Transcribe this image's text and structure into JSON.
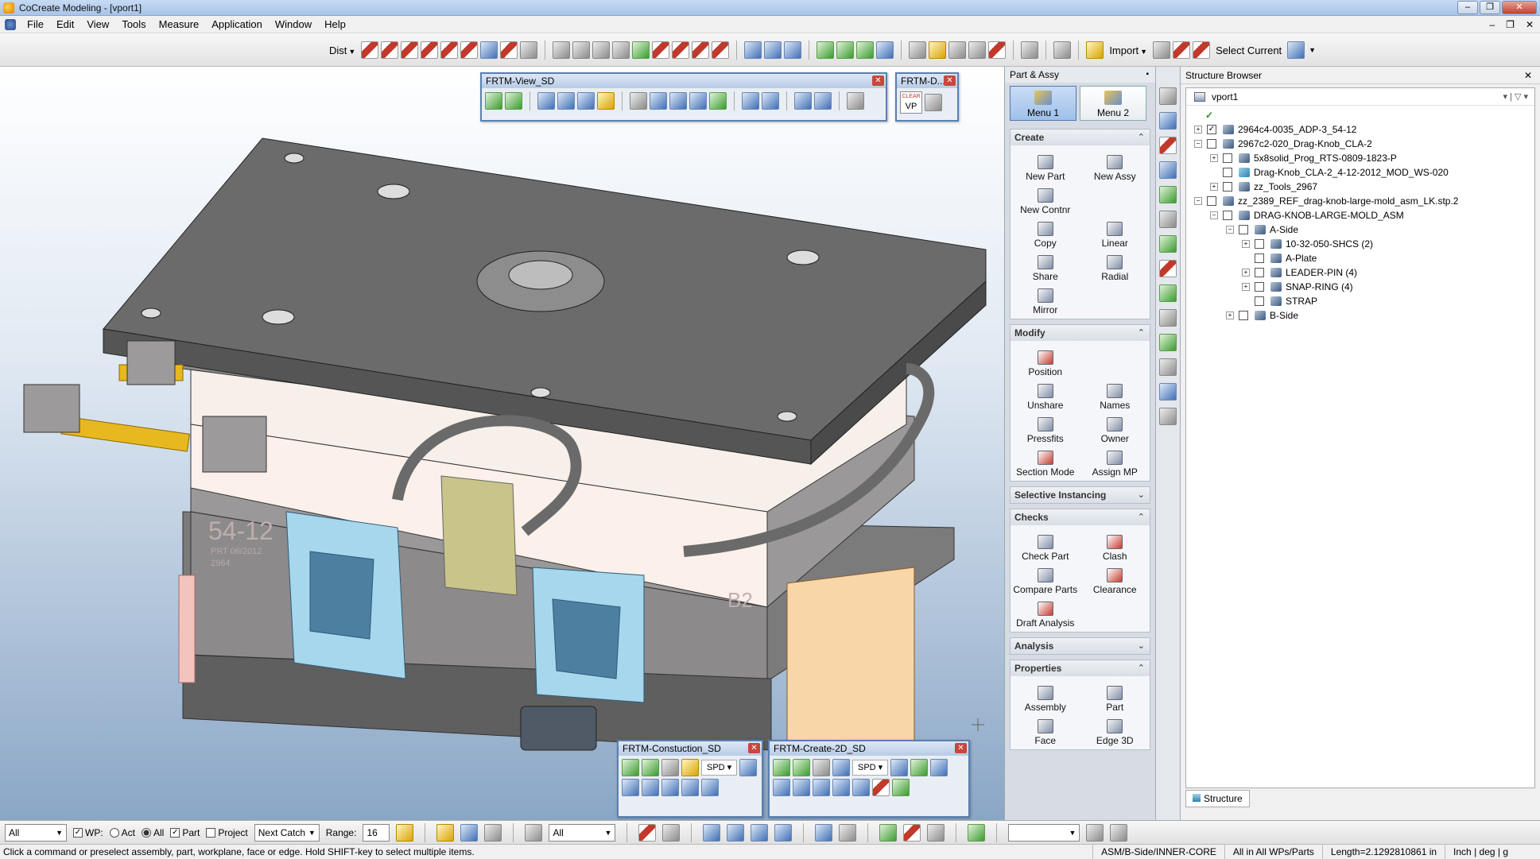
{
  "window": {
    "title": "CoCreate Modeling - [vport1]"
  },
  "menu": [
    "File",
    "Edit",
    "View",
    "Tools",
    "Measure",
    "Application",
    "Window",
    "Help"
  ],
  "toolbar": {
    "dist_label": "Dist",
    "import_label": "Import",
    "select_current_label": "Select Current"
  },
  "float_toolbars": {
    "view": {
      "title": "FRTM-View_SD"
    },
    "vp": {
      "title": "FRTM-D...",
      "clear_label": "CLEAR",
      "vp_label": "VP"
    },
    "construction": {
      "title": "FRTM-Constuction_SD",
      "spd": "SPD"
    },
    "create2d": {
      "title": "FRTM-Create-2D_SD",
      "spd": "SPD"
    }
  },
  "part_assy": {
    "title": "Part & Assy",
    "tabs": [
      "Menu 1",
      "Menu 2"
    ],
    "sections": [
      {
        "title": "Create",
        "collapsible": "up",
        "items": [
          "New Part",
          "New Assy",
          "New Contnr",
          "",
          "Copy",
          "Linear",
          "Share",
          "Radial",
          "Mirror",
          ""
        ]
      },
      {
        "title": "Modify",
        "collapsible": "up",
        "items": [
          "Position",
          "",
          "Unshare",
          "Names",
          "Pressfits",
          "Owner",
          "Section Mode",
          "Assign MP"
        ]
      },
      {
        "title": "Selective Instancing",
        "collapsible": "down",
        "items": []
      },
      {
        "title": "Checks",
        "collapsible": "up",
        "items": [
          "Check Part",
          "Clash",
          "Compare Parts",
          "Clearance",
          "Draft Analysis",
          ""
        ]
      },
      {
        "title": "Analysis",
        "collapsible": "down",
        "items": []
      },
      {
        "title": "Properties",
        "collapsible": "up",
        "items": [
          "Assembly",
          "Part",
          "Face",
          "Edge 3D"
        ]
      }
    ]
  },
  "structure_browser": {
    "title": "Structure Browser",
    "root": "vport1",
    "rows": [
      {
        "label": "2964c4-0035_ADP-3_54-12",
        "checked": true,
        "type": "asm"
      },
      {
        "label": "2967c2-020_Drag-Knob_CLA-2",
        "checked": false,
        "type": "asm"
      },
      {
        "label": "5x8solid_Prog_RTS-0809-1823-P",
        "checked": false,
        "type": "asm"
      },
      {
        "label": "Drag-Knob_CLA-2_4-12-2012_MOD_WS-020",
        "checked": false,
        "type": "part"
      },
      {
        "label": "zz_Tools_2967",
        "checked": false,
        "type": "asm"
      },
      {
        "label": "zz_2389_REF_drag-knob-large-mold_asm_LK.stp.2",
        "checked": false,
        "type": "asm"
      },
      {
        "label": "DRAG-KNOB-LARGE-MOLD_ASM",
        "checked": false,
        "type": "asm"
      },
      {
        "label": "A-Side",
        "checked": false,
        "type": "asm"
      },
      {
        "label": "10-32-050-SHCS (2)",
        "checked": false,
        "type": "asm"
      },
      {
        "label": "A-Plate",
        "checked": false,
        "type": "part"
      },
      {
        "label": "LEADER-PIN (4)",
        "checked": false,
        "type": "asm"
      },
      {
        "label": "SNAP-RING (4)",
        "checked": false,
        "type": "asm"
      },
      {
        "label": "STRAP",
        "checked": false,
        "type": "part"
      },
      {
        "label": "B-Side",
        "checked": false,
        "type": "asm"
      }
    ],
    "tab": "Structure"
  },
  "selection_bar": {
    "filter": "All",
    "wp_label": "WP:",
    "act_label": "Act",
    "all_label": "All",
    "part_label": "Part",
    "project_label": "Project",
    "next_catch": "Next Catch",
    "range_label": "Range:",
    "range_value": "16",
    "filter2": "All"
  },
  "viewport_labels": {
    "engraving1": "54-12",
    "engraving2": "B2",
    "text_prt": "PRT 06/2012",
    "text_num": "2964"
  },
  "status": {
    "message": "Click a command or preselect assembly, part, workplane, face or edge. Hold SHIFT-key to select multiple items.",
    "path": "ASM/B-Side/INNER-CORE",
    "wp": "All in All WPs/Parts",
    "length": "Length=2.1292810861 in",
    "units": "Inch | deg | g"
  }
}
